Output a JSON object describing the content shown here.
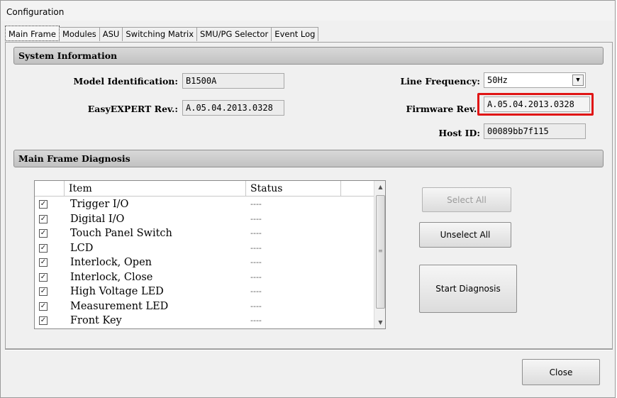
{
  "window": {
    "title": "Configuration"
  },
  "tabs": [
    {
      "label": "Main Frame",
      "active": true
    },
    {
      "label": "Modules",
      "active": false
    },
    {
      "label": "ASU",
      "active": false
    },
    {
      "label": "Switching Matrix",
      "active": false
    },
    {
      "label": "SMU/PG Selector",
      "active": false
    },
    {
      "label": "Event Log",
      "active": false
    }
  ],
  "system_info": {
    "heading": "System Information",
    "model_label": "Model Identification:",
    "model_value": "B1500A",
    "easyexpert_label": "EasyEXPERT Rev.:",
    "easyexpert_value": "A.05.04.2013.0328",
    "line_freq_label": "Line Frequency:",
    "line_freq_value": "50Hz",
    "firmware_label": "Firmware Rev.:",
    "firmware_value": "A.05.04.2013.0328",
    "host_label": "Host ID:",
    "host_value": "00089bb7f115",
    "highlight_color": "#e01515"
  },
  "diagnosis": {
    "heading": "Main Frame Diagnosis",
    "columns": [
      "Item",
      "Status"
    ],
    "rows": [
      {
        "item": "Trigger I/O",
        "status": "----",
        "checked": true
      },
      {
        "item": "Digital I/O",
        "status": "----",
        "checked": true
      },
      {
        "item": "Touch Panel Switch",
        "status": "----",
        "checked": true
      },
      {
        "item": "LCD",
        "status": "----",
        "checked": true
      },
      {
        "item": "Interlock, Open",
        "status": "----",
        "checked": true
      },
      {
        "item": "Interlock, Close",
        "status": "----",
        "checked": true
      },
      {
        "item": "High Voltage LED",
        "status": "----",
        "checked": true
      },
      {
        "item": "Measurement LED",
        "status": "----",
        "checked": true
      },
      {
        "item": "Front Key",
        "status": "----",
        "checked": true
      }
    ],
    "select_all_label": "Select All",
    "unselect_all_label": "Unselect All",
    "start_label": "Start Diagnosis"
  },
  "footer": {
    "close_label": "Close"
  }
}
